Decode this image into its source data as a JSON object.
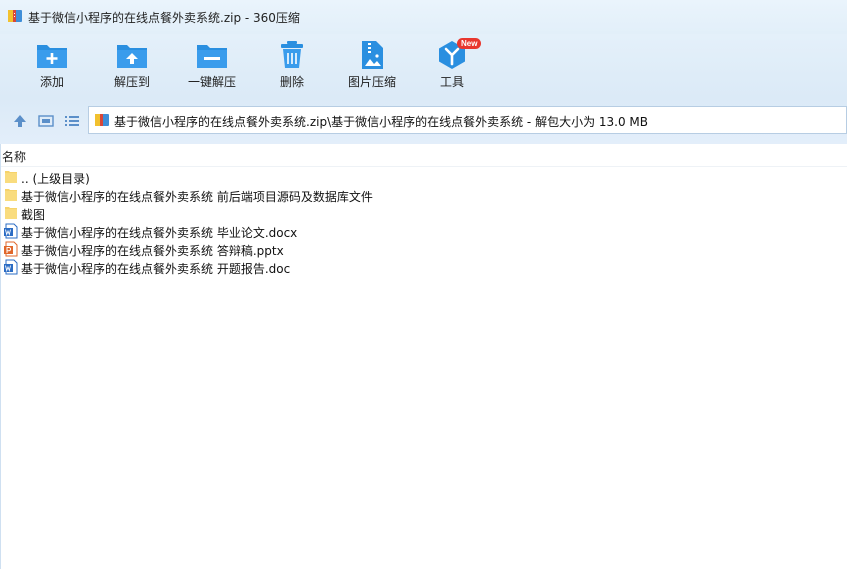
{
  "window": {
    "title": "基于微信小程序的在线点餐外卖系统.zip - 360压缩"
  },
  "toolbar": {
    "buttons": [
      {
        "label": "添加",
        "icon": "folder-add-icon"
      },
      {
        "label": "解压到",
        "icon": "folder-extract-icon"
      },
      {
        "label": "一键解压",
        "icon": "folder-oneclick-icon"
      },
      {
        "label": "删除",
        "icon": "trash-icon"
      },
      {
        "label": "图片压缩",
        "icon": "image-zip-icon"
      },
      {
        "label": "工具",
        "icon": "tools-icon",
        "badge": "New"
      }
    ]
  },
  "navigation": {
    "address": "基于微信小程序的在线点餐外卖系统.zip\\基于微信小程序的在线点餐外卖系统 - 解包大小为 13.0 MB"
  },
  "filelist": {
    "column_name": "名称",
    "items": [
      {
        "name": ".. (上级目录)",
        "type": "folder"
      },
      {
        "name": "基于微信小程序的在线点餐外卖系统 前后端项目源码及数据库文件",
        "type": "folder"
      },
      {
        "name": "截图",
        "type": "folder"
      },
      {
        "name": "基于微信小程序的在线点餐外卖系统 毕业论文.docx",
        "type": "word"
      },
      {
        "name": "基于微信小程序的在线点餐外卖系统 答辩稿.pptx",
        "type": "ppt"
      },
      {
        "name": "基于微信小程序的在线点餐外卖系统 开题报告.doc",
        "type": "word"
      }
    ]
  },
  "colors": {
    "accent": "#2a8fe0",
    "folder": "#f6d36b",
    "word": "#2b6cc4",
    "ppt": "#e0672b",
    "badge": "#e8372f"
  }
}
